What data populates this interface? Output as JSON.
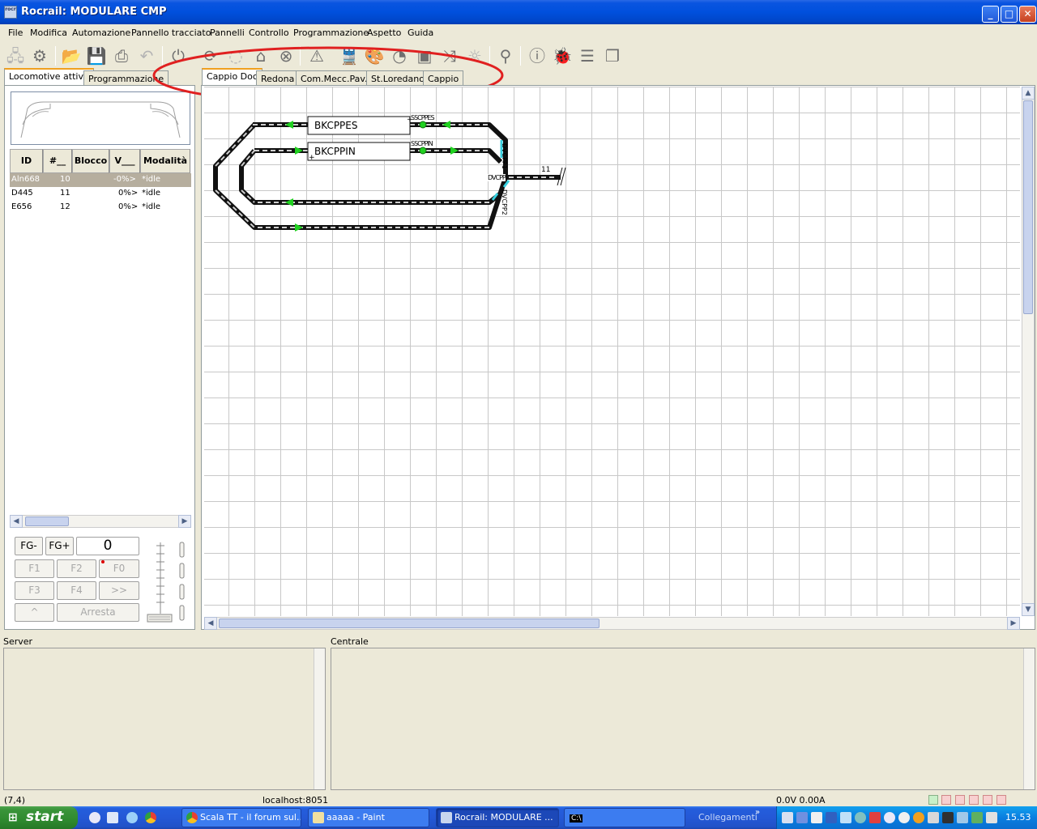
{
  "window": {
    "title": "Rocrail: MODULARE CMP",
    "icon_text": "rocr"
  },
  "menu": [
    "File",
    "Modifica",
    "Automazione",
    "Pannello tracciato",
    "Pannelli",
    "Controllo",
    "Programmazione",
    "Aspetto",
    "Guida"
  ],
  "left_tabs": [
    "Locomotive attive",
    "Programmazione"
  ],
  "plan_tabs": [
    "Cappio Doc",
    "Redona",
    "Com.Mecc.Pav.",
    "St.Loredano",
    "Cappio"
  ],
  "loco_table": {
    "headers": [
      "ID",
      "#__",
      "Blocco",
      "V___",
      "Modalità"
    ],
    "rows": [
      {
        "id": "Aln668",
        "num": "10",
        "block": "",
        "speed": "-0%>",
        "mode": "*idle"
      },
      {
        "id": "D445",
        "num": "11",
        "block": "",
        "speed": "0%>",
        "mode": "*idle"
      },
      {
        "id": "E656",
        "num": "12",
        "block": "",
        "speed": "0%>",
        "mode": "*idle"
      }
    ]
  },
  "throttle": {
    "fg_minus": "FG-",
    "fg_plus": "FG+",
    "fg_value": "0",
    "f1": "F1",
    "f2": "F2",
    "f0": "F0",
    "f3": "F3",
    "f4": "F4",
    "more": ">>",
    "up": "^",
    "stop": "Arresta"
  },
  "track": {
    "blocks": [
      "BKCPPES",
      "BKCPPIN"
    ],
    "sensors": [
      "SSCPPES",
      "SSCPPIN"
    ],
    "switches": [
      "DVCPP1",
      "DVCPP2",
      "DVCPP"
    ],
    "label_11": "11"
  },
  "bottom": {
    "server_label": "Server",
    "central_label": "Centrale"
  },
  "status": {
    "coords": "(7,4)",
    "host": "localhost:8051",
    "power": "0.0V 0.00A"
  },
  "taskbar": {
    "start": "start",
    "tasks": [
      "Scala TT - il forum sul...",
      "aaaaa - Paint",
      "Rocrail: MODULARE ...",
      "C:\\"
    ],
    "links": "Collegamenti",
    "time": "15.53"
  }
}
